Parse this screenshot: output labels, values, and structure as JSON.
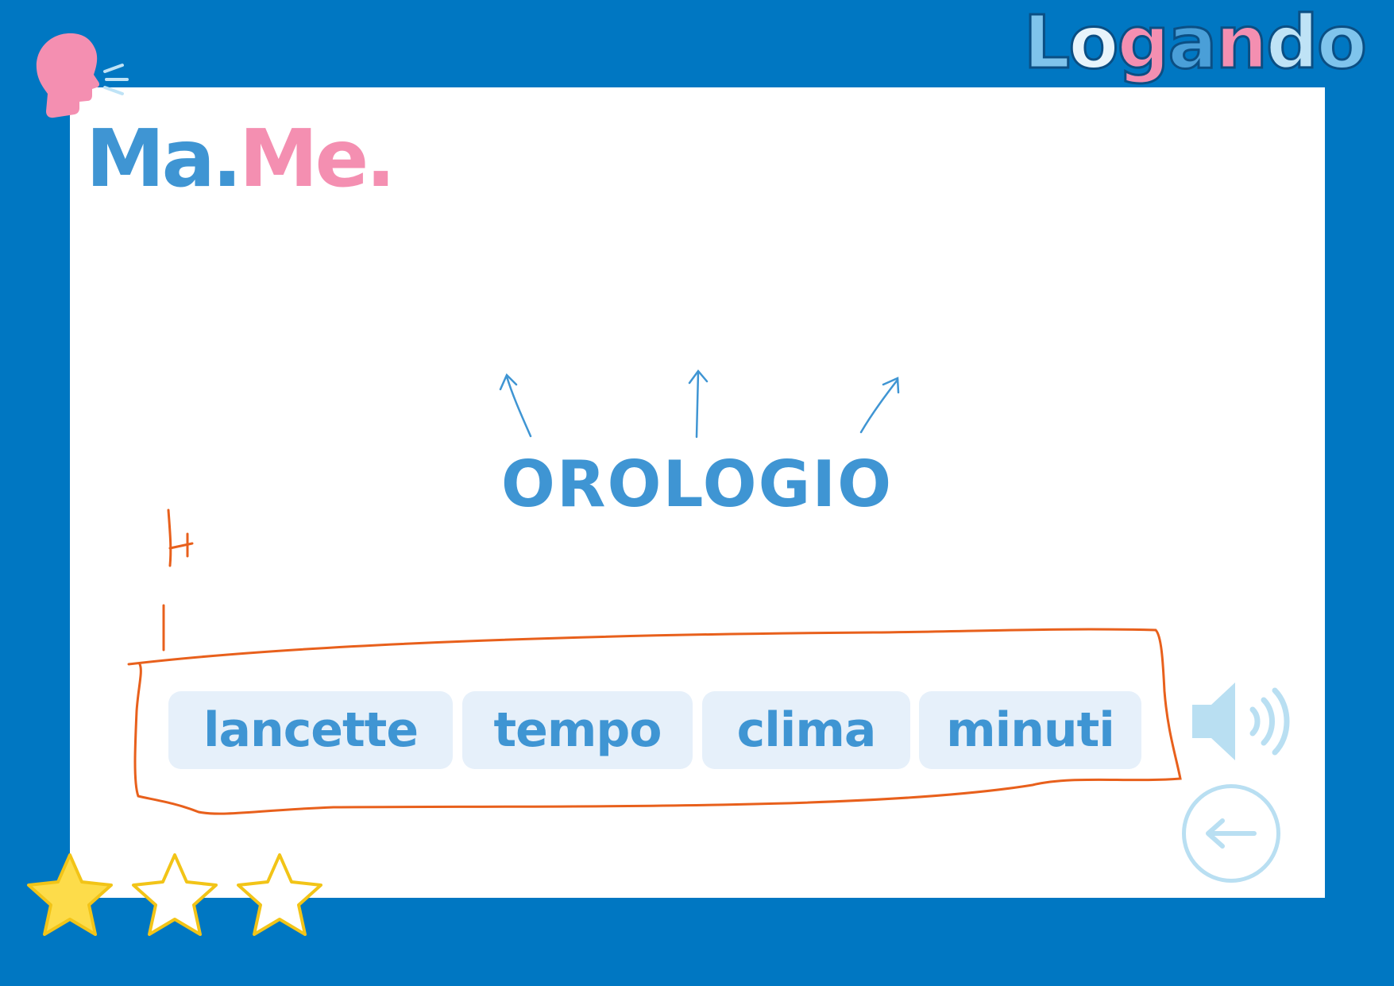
{
  "brand": {
    "letters": [
      "L",
      "o",
      "g",
      "a",
      "n",
      "d",
      "o"
    ]
  },
  "header": {
    "title_part1": "Ma.",
    "title_part2": "Me."
  },
  "exercise": {
    "word": "OROLOGIO",
    "options": [
      "lancette",
      "tempo",
      "clima",
      "minuti"
    ],
    "annotation_count": "4"
  },
  "controls": {
    "audio_icon": "speaker-icon",
    "back_icon": "arrow-left-icon"
  },
  "rating": {
    "stars_total": 3,
    "stars_filled": 1
  },
  "colors": {
    "background": "#0077c2",
    "primary_text": "#3f95d3",
    "accent_pink": "#f48fb1",
    "chip_bg": "#e6f0fa",
    "annotation": "#e8601c",
    "star_fill": "#fddc4a"
  }
}
